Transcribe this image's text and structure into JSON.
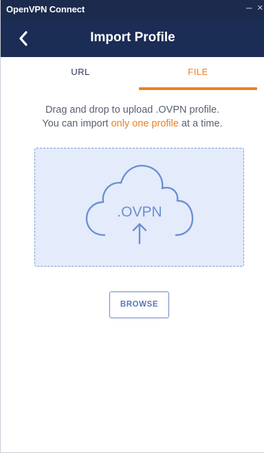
{
  "window": {
    "title": "OpenVPN Connect",
    "minimize_glyph": "–",
    "close_glyph": "×"
  },
  "header": {
    "title": "Import Profile",
    "back_icon": "chevron-left-icon"
  },
  "tabs": [
    {
      "label": "URL",
      "active": false
    },
    {
      "label": "FILE",
      "active": true
    }
  ],
  "instructions": {
    "line1": "Drag and drop to upload .OVPN profile.",
    "line2_prefix": "You can import ",
    "line2_highlight": "only one profile",
    "line2_suffix": " at a time."
  },
  "dropzone": {
    "icon": "cloud-upload-icon",
    "icon_label": ".OVPN"
  },
  "browse": {
    "label": "BROWSE"
  },
  "colors": {
    "titlebar": "#1c2a4d",
    "header": "#1b2c55",
    "accent": "#ee7f22",
    "dropzone_bg": "#e4ebfa",
    "icon_blue": "#6b8fd4"
  }
}
